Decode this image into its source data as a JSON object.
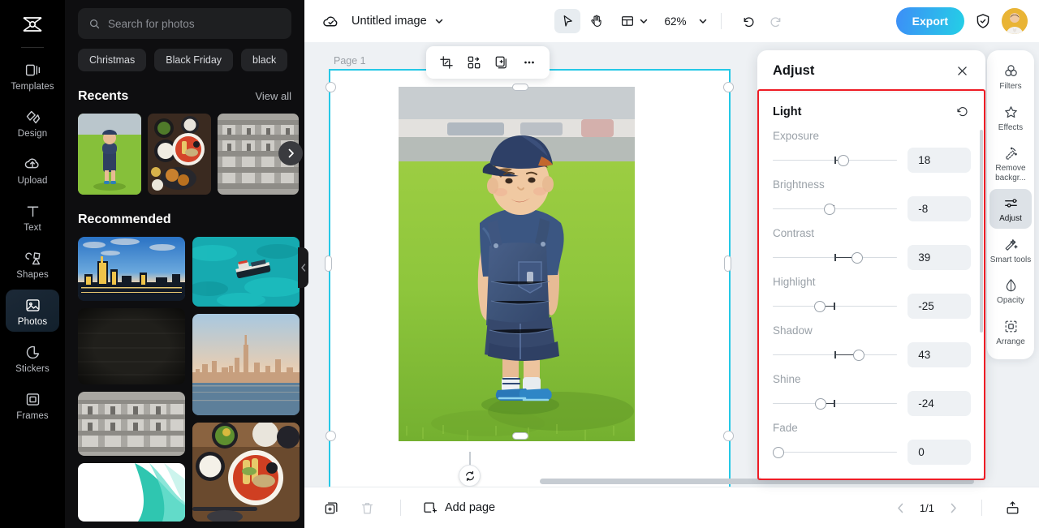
{
  "left_rail": {
    "logo": "capcut-logo",
    "items": [
      {
        "label": "Templates",
        "icon": "templates-icon",
        "active": false
      },
      {
        "label": "Design",
        "icon": "design-icon",
        "active": false
      },
      {
        "label": "Upload",
        "icon": "upload-icon",
        "active": false
      },
      {
        "label": "Text",
        "icon": "text-icon",
        "active": false
      },
      {
        "label": "Shapes",
        "icon": "shapes-icon",
        "active": false
      },
      {
        "label": "Photos",
        "icon": "photos-icon",
        "active": true
      },
      {
        "label": "Stickers",
        "icon": "stickers-icon",
        "active": false
      },
      {
        "label": "Frames",
        "icon": "frames-icon",
        "active": false
      }
    ]
  },
  "photos_panel": {
    "search": {
      "placeholder": "Search for photos",
      "value": "",
      "icon": "search-icon"
    },
    "chips": [
      "Christmas",
      "Black Friday",
      "black"
    ],
    "recents": {
      "title": "Recents",
      "view_all": "View all",
      "next_icon": "chevron-right-icon"
    },
    "recommended": {
      "title": "Recommended"
    },
    "collapse_icon": "chevron-left-icon"
  },
  "topbar": {
    "cloud_icon": "cloud-saved-icon",
    "doc_title": "Untitled image",
    "title_caret": "chevron-down-icon",
    "tools": [
      {
        "name": "select-tool",
        "icon": "cursor-icon",
        "selected": true
      },
      {
        "name": "hand-tool",
        "icon": "hand-icon",
        "selected": false
      },
      {
        "name": "layout-tool",
        "icon": "layout-icon",
        "selected": false
      }
    ],
    "zoom": "62%",
    "zoom_caret": "chevron-down-icon",
    "undo_icon": "undo-icon",
    "redo_icon": "redo-icon",
    "export_label": "Export",
    "shield_icon": "shield-check-icon",
    "avatar": "user-avatar"
  },
  "canvas": {
    "page_label": "Page 1",
    "float_tools": [
      {
        "name": "crop-button",
        "icon": "crop-icon"
      },
      {
        "name": "replace-button",
        "icon": "replace-icon"
      },
      {
        "name": "duplicate-button",
        "icon": "duplicate-icon"
      },
      {
        "name": "more-button",
        "icon": "more-dots-icon"
      }
    ],
    "rotate_icon": "rotate-icon",
    "image_alt": "toddler-in-denim-overalls-on-grass"
  },
  "adjust_panel": {
    "title": "Adjust",
    "close_icon": "close-icon",
    "group": {
      "title": "Light",
      "reset_icon": "reset-icon",
      "controls": [
        {
          "label": "Exposure",
          "value": "18",
          "pos": 57,
          "min": -100,
          "max": 100
        },
        {
          "label": "Brightness",
          "value": "-8",
          "pos": 46,
          "min": -100,
          "max": 100
        },
        {
          "label": "Contrast",
          "value": "39",
          "pos": 69,
          "min": -100,
          "max": 100
        },
        {
          "label": "Highlight",
          "value": "-25",
          "pos": 37,
          "min": -100,
          "max": 100
        },
        {
          "label": "Shadow",
          "value": "43",
          "pos": 71,
          "min": -100,
          "max": 100
        },
        {
          "label": "Shine",
          "value": "-24",
          "pos": 38,
          "min": -100,
          "max": 100
        },
        {
          "label": "Fade",
          "value": "0",
          "pos": 0,
          "min": 0,
          "max": 100
        }
      ]
    },
    "highlight_border_color": "#ee1c25"
  },
  "right_rail": {
    "items": [
      {
        "label": "Filters",
        "icon": "filters-icon",
        "active": false
      },
      {
        "label": "Effects",
        "icon": "effects-icon",
        "active": false
      },
      {
        "label": "Remove backgr...",
        "icon": "remove-background-icon",
        "active": false
      },
      {
        "label": "Adjust",
        "icon": "adjust-icon",
        "active": true
      },
      {
        "label": "Smart tools",
        "icon": "smart-tools-icon",
        "active": false
      },
      {
        "label": "Opacity",
        "icon": "opacity-icon",
        "active": false
      },
      {
        "label": "Arrange",
        "icon": "arrange-icon",
        "active": false
      }
    ]
  },
  "bottombar": {
    "duplicate_page_icon": "duplicate-page-icon",
    "delete_page_icon": "trash-icon",
    "add_page_label": "Add page",
    "add_page_icon": "add-page-icon",
    "prev_icon": "chevron-left-icon",
    "pager": "1/1",
    "next_icon": "chevron-right-icon",
    "present_icon": "present-icon"
  },
  "colors": {
    "accent_cyan": "#25c8e6",
    "export_gradient_from": "#3d8ef7",
    "export_gradient_to": "#24cfe6",
    "panel_dark": "#0e0e10",
    "rail_black": "#000000",
    "canvas_bg": "#eef1f4",
    "highlight_red": "#ee1c25"
  }
}
